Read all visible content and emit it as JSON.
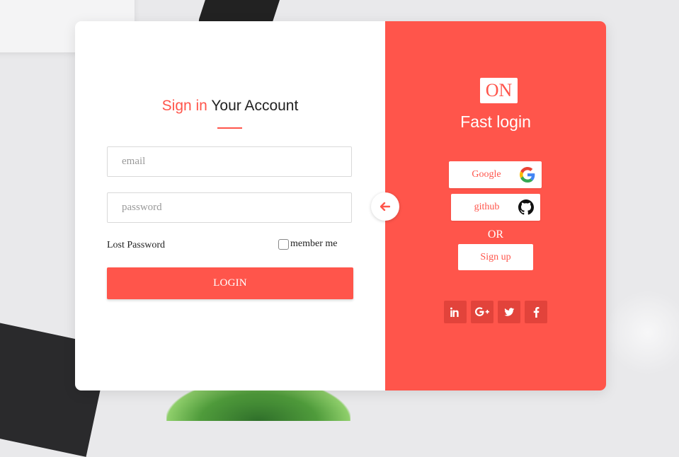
{
  "colors": {
    "accent": "#ff554b",
    "accent_dark": "#e2433b",
    "panel": "#ffffff"
  },
  "signin": {
    "title_accent": "Sign in",
    "title_rest": " Your Account",
    "email_placeholder": "email",
    "password_placeholder": "password",
    "lost_password": "Lost Password",
    "remember_label": "member me",
    "login_label": "LOGIN"
  },
  "fast": {
    "logo": "ON",
    "title": "Fast login",
    "google_label": "Google",
    "github_label": "github",
    "or_label": "OR",
    "signup_label": "Sign up"
  },
  "icons": {
    "toggle": "arrow-left-icon",
    "social": [
      "linkedin-icon",
      "google-plus-icon",
      "twitter-icon",
      "facebook-icon"
    ]
  }
}
